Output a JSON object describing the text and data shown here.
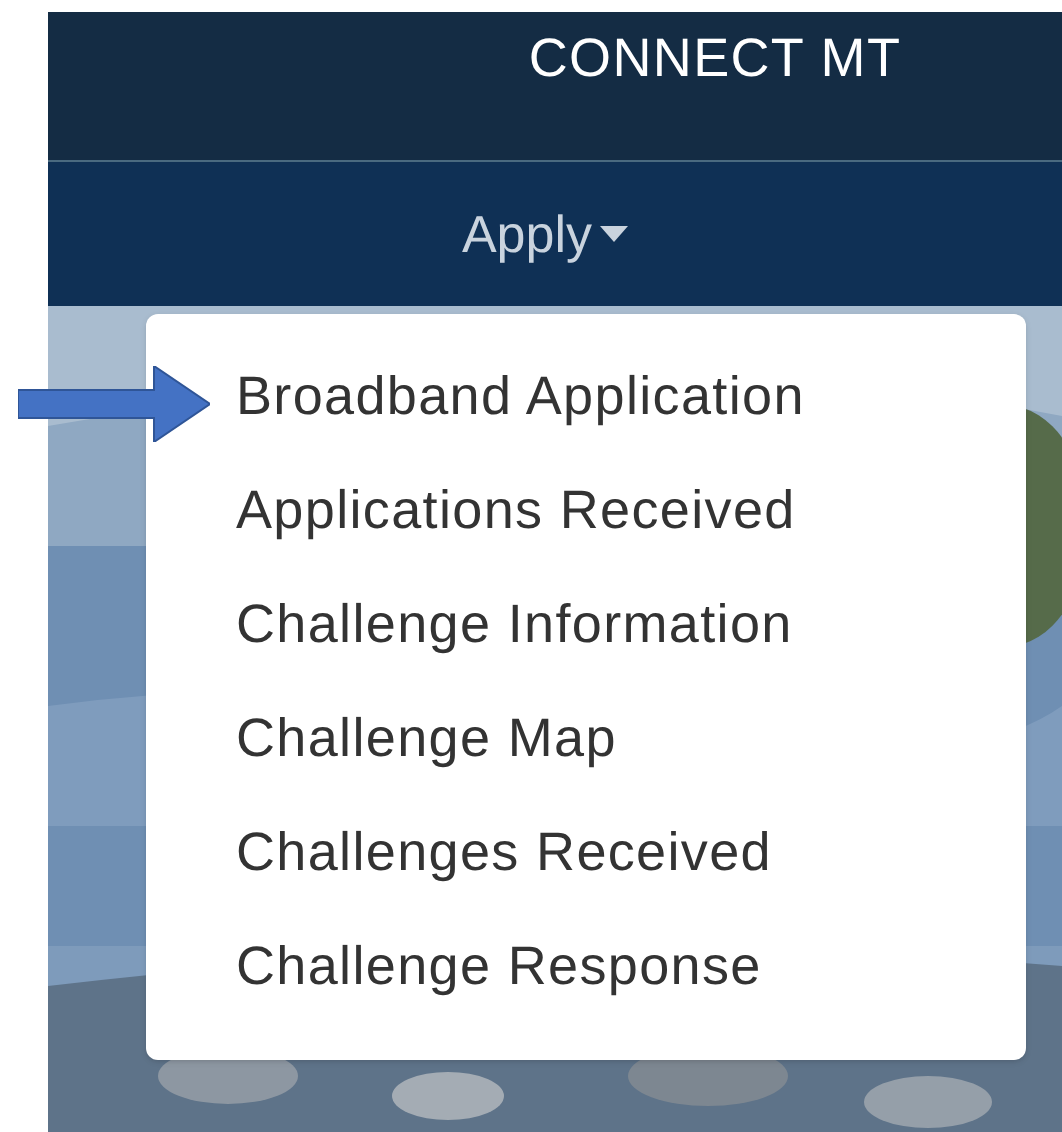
{
  "header": {
    "title": "CONNECT MT"
  },
  "nav": {
    "items": [
      {
        "label": "Apply",
        "expanded": true
      }
    ]
  },
  "dropdown": {
    "items": [
      {
        "label": "Broadband Application",
        "arrow": true
      },
      {
        "label": "Applications Received",
        "arrow": false
      },
      {
        "label": "Challenge Information",
        "arrow": false
      },
      {
        "label": "Challenge Map",
        "arrow": false
      },
      {
        "label": "Challenges Received",
        "arrow": false
      },
      {
        "label": "Challenge Response",
        "arrow": false
      }
    ]
  }
}
